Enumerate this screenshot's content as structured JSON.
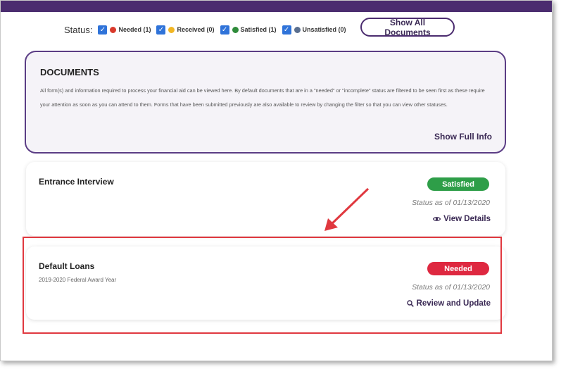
{
  "status_filter": {
    "label": "Status:",
    "items": [
      {
        "label": "Needed (1)",
        "color": "#d9392b",
        "checked": true
      },
      {
        "label": "Received (0)",
        "color": "#f2b623",
        "checked": true
      },
      {
        "label": "Satisfied (1)",
        "color": "#2e8b3a",
        "checked": true
      },
      {
        "label": "Unsatisfied (0)",
        "color": "#5a6f8f",
        "checked": true
      }
    ],
    "show_all_label": "Show All Documents"
  },
  "documents": {
    "title": "DOCUMENTS",
    "description": "All form(s) and information required to process your financial aid can be viewed here. By default documents that are in a \"needed\" or \"incomplete\" status are filtered to be seen first as these require your attention as soon as you can attend to them. Forms that have been submitted previously are also available to review by changing the filter so that you can view other statuses.",
    "show_full_label": "Show Full Info"
  },
  "items": [
    {
      "title": "Entrance Interview",
      "badge": "Satisfied",
      "badge_color": "#2e9e48",
      "status_date": "Status as of 01/13/2020",
      "action": "View Details",
      "action_icon": "eye-icon"
    },
    {
      "title": "Default Loans",
      "subtitle": "2019-2020 Federal Award Year",
      "badge": "Needed",
      "badge_color": "#de2840",
      "status_date": "Status as of 01/13/2020",
      "action": "Review and Update",
      "action_icon": "magnifier-icon"
    }
  ],
  "colors": {
    "brand": "#4b2c6f",
    "annotation": "#e0383f",
    "check": "#2f73d9"
  }
}
